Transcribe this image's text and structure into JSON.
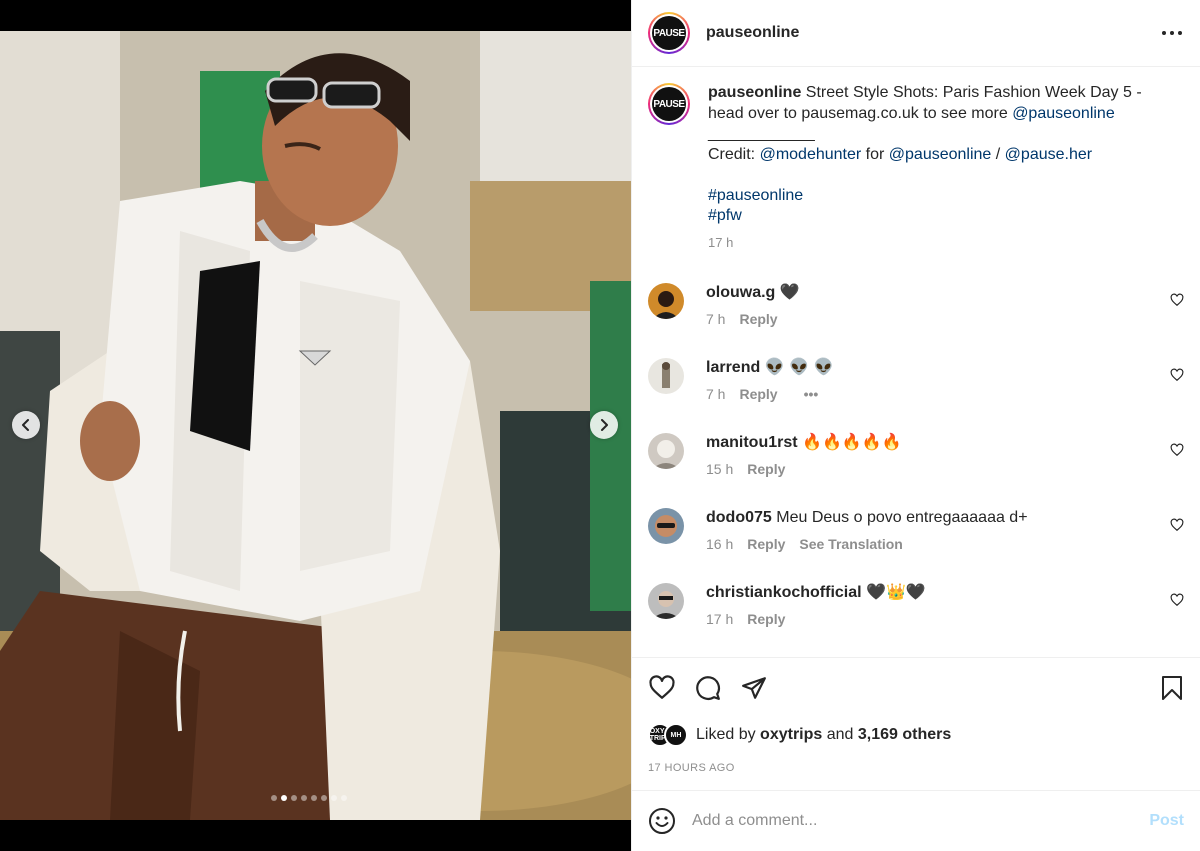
{
  "post": {
    "username": "pauseonline",
    "avatar_text": "PAUSE",
    "caption": {
      "username": "pauseonline",
      "text": " Street Style Shots: Paris Fashion Week Day 5 - head over to pausemag.co.uk to see more ",
      "mention_main": "@pauseonline",
      "divider": "____________",
      "credit_label": "Credit: ",
      "credit_mention1": "@modehunter",
      "credit_for": " for ",
      "credit_mention2": "@pauseonline",
      "credit_sep": " / ",
      "credit_mention3": "@pause.her",
      "hashtag1": "#pauseonline",
      "hashtag2": "#pfw",
      "time": "17 h"
    }
  },
  "comments": [
    {
      "username": "olouwa.g",
      "text": "🖤",
      "time": "7 h",
      "reply": "Reply",
      "avatar_color": "#d08a2a"
    },
    {
      "username": "larrend",
      "text": "👽 👽 👽",
      "time": "7 h",
      "reply": "Reply",
      "more": "•••",
      "avatar_color": "#e8e6e0"
    },
    {
      "username": "manitou1rst",
      "text": "🔥🔥🔥🔥🔥",
      "time": "15 h",
      "reply": "Reply",
      "avatar_color": "#cfc9c2"
    },
    {
      "username": "dodo075",
      "text": "Meu Deus o povo entregaaaaaa d+",
      "time": "16 h",
      "reply": "Reply",
      "translation": "See Translation",
      "avatar_color": "#7a93a8"
    },
    {
      "username": "christiankochofficial",
      "text": "🖤👑🖤",
      "time": "17 h",
      "reply": "Reply",
      "avatar_color": "#bdbdbd"
    }
  ],
  "likes": {
    "liked_by": "Liked by ",
    "liker": "oxytrips",
    "and": " and ",
    "others": "3,169 others",
    "avatar1_text": "OXY TRIPS",
    "avatar2_text": "MH"
  },
  "posted_ago": "17 HOURS AGO",
  "comment_box": {
    "placeholder": "Add a comment...",
    "post_label": "Post"
  },
  "carousel": {
    "dot_count": 8,
    "active_index": 1
  },
  "colors": {
    "link": "#00376b",
    "muted": "#8e8e8e",
    "post_disabled": "#b2dffc"
  }
}
